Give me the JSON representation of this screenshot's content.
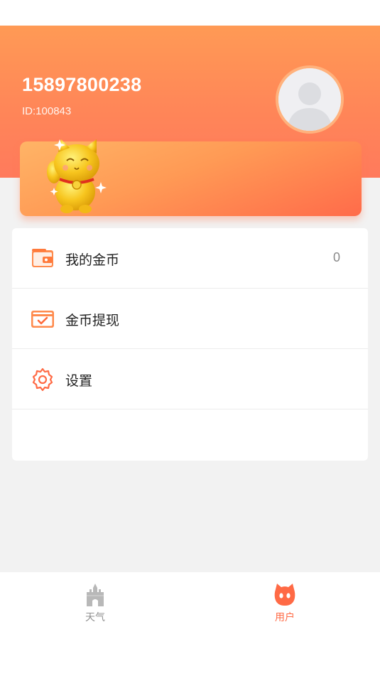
{
  "profile": {
    "phone": "15897800238",
    "id_text": "ID:100843"
  },
  "menu": {
    "items": [
      {
        "label": "我的金币",
        "value": "0",
        "icon": "wallet-icon"
      },
      {
        "label": "金币提现",
        "value": "",
        "icon": "withdraw-card-icon"
      },
      {
        "label": "设置",
        "value": "",
        "icon": "gear-icon"
      }
    ]
  },
  "tabbar": {
    "tabs": [
      {
        "label": "天气",
        "icon": "castle-icon",
        "active": false
      },
      {
        "label": "用户",
        "icon": "cat-face-icon",
        "active": true
      }
    ]
  },
  "colors": {
    "accent": "#ff7a4f",
    "header_top": "#ff9a55",
    "header_bottom": "#ff7a5c",
    "inactive_tab": "#8f8f8f",
    "active_tab": "#ff6a45"
  }
}
